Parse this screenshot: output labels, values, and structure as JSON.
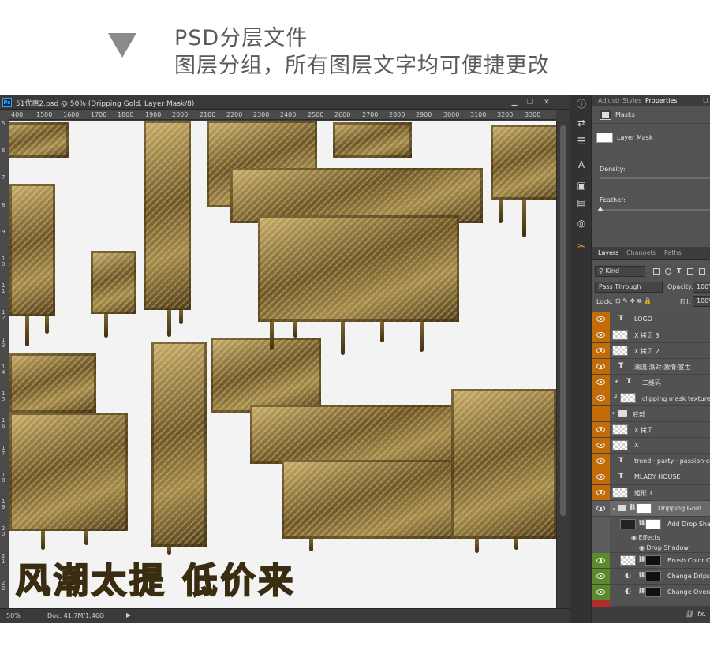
{
  "header": {
    "line1": "PSD分层文件",
    "line2": "图层分组，所有图层文字均可便捷更改"
  },
  "document": {
    "ps_badge": "Ps",
    "title": "51优惠2.psd @ 50% (Dripping Gold, Layer Mask/8)",
    "minimize": "▁",
    "restore": "❐",
    "close": "✕",
    "ruler_top": [
      "400",
      "1500",
      "1600",
      "1700",
      "1800",
      "1900",
      "2000",
      "2100",
      "2200",
      "2300",
      "2400",
      "2500",
      "2600",
      "2700",
      "2800",
      "2900",
      "3000",
      "3100",
      "3200",
      "3300"
    ],
    "ruler_left": [
      "5",
      "6",
      "7",
      "8",
      "9",
      "10",
      "11",
      "12",
      "13",
      "14",
      "15",
      "16",
      "17",
      "18",
      "19",
      "20",
      "21",
      "22"
    ],
    "canvas_text": "风潮太提 低价来",
    "status_zoom": "50%",
    "status_doc": "Doc: 41.7M/1.46G",
    "status_arrow": "▶"
  },
  "tool_strip": {
    "icons": [
      "info-icon",
      "adjust-icon",
      "sliders-icon",
      "character-icon",
      "navigator-icon",
      "notes-icon",
      "brush-preset-icon",
      "tools-icon"
    ],
    "glyphs": [
      "ⓘ",
      "⇄",
      "☰",
      "A",
      "▣",
      "▤",
      "◎",
      "✂"
    ]
  },
  "properties": {
    "tabs": [
      "Adjustr",
      "Styles",
      "Properties",
      "Li"
    ],
    "active_tab": "Properties",
    "section": "Masks",
    "layer_mask_label": "Layer Mask",
    "density_label": "Density:",
    "feather_label": "Feather:"
  },
  "layers_panel": {
    "tabs": [
      "Layers",
      "Channels",
      "Paths"
    ],
    "active_tab": "Layers",
    "kind_value": "Kind",
    "blend_mode": "Pass Through",
    "opacity_label": "Opacity:",
    "opacity_value": "100%",
    "lock_label": "Lock:",
    "fill_label": "Fill:",
    "fill_value": "100%",
    "layers": [
      {
        "name": "LOGO",
        "kind": "text",
        "vis": "orange"
      },
      {
        "name": "X 拷贝 3",
        "kind": "pixel",
        "vis": "orange"
      },
      {
        "name": "X 拷贝 2",
        "kind": "pixel",
        "vis": "orange"
      },
      {
        "name": "潮流·派对·激情·宣世",
        "kind": "text",
        "vis": "orange"
      },
      {
        "name": "二维码",
        "kind": "text-clip",
        "vis": "orange"
      },
      {
        "name": "clipping mask texture 拷",
        "kind": "pixel-clip",
        "vis": "orange"
      },
      {
        "name": "底部",
        "kind": "group",
        "vis": "orange"
      },
      {
        "name": "X 拷贝",
        "kind": "pixel",
        "vis": "orange"
      },
      {
        "name": "X",
        "kind": "pixel",
        "vis": "orange"
      },
      {
        "name": "trend · party · passion·catha",
        "kind": "text",
        "vis": "orange"
      },
      {
        "name": "MLADY HOUSE",
        "kind": "text",
        "vis": "orange"
      },
      {
        "name": "矩形 1",
        "kind": "pixel",
        "vis": "orange"
      },
      {
        "name": "Dripping Gold",
        "kind": "group-open",
        "vis": "gray"
      },
      {
        "name": "Add Drop Shac",
        "kind": "masked",
        "vis": "gray"
      },
      {
        "name": "Brush Color Or",
        "kind": "adjust",
        "vis": "green"
      },
      {
        "name": "Change Drips C",
        "kind": "adjust",
        "vis": "green"
      },
      {
        "name": "Change Overal",
        "kind": "adjust",
        "vis": "green"
      }
    ],
    "effects_label": "Effects",
    "drop_shadow_label": "Drop Shadow",
    "bottom_link": "⛓",
    "bottom_fx": "fx."
  }
}
